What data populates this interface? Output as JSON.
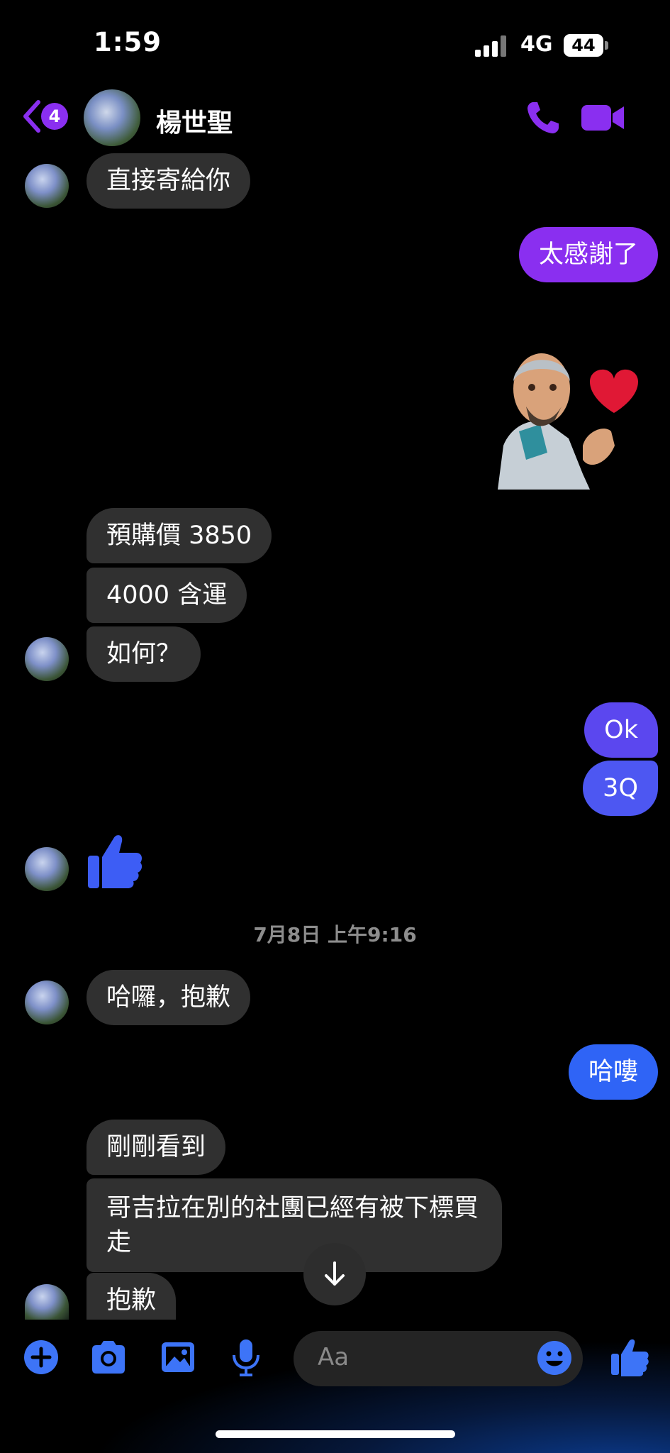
{
  "status_bar": {
    "time": "1:59",
    "network": "4G",
    "battery": "44"
  },
  "header": {
    "back_badge": "4",
    "contact_name": "楊世聖"
  },
  "colors": {
    "accent_purple": "#8a2ff0",
    "accent_blue": "#2f64f6",
    "incoming_bubble": "#303030"
  },
  "messages": [
    {
      "side": "in",
      "text": "直接寄給你"
    },
    {
      "side": "out",
      "text": "太感謝了"
    },
    {
      "side": "out",
      "type": "sticker",
      "icon": "avatar-heart-sticker"
    },
    {
      "side": "in",
      "text": "預購價 3850"
    },
    {
      "side": "in",
      "text": "4000 含運"
    },
    {
      "side": "in",
      "text": "如何？"
    },
    {
      "side": "out",
      "text": "Ok"
    },
    {
      "side": "out",
      "text": "3Q"
    },
    {
      "side": "in",
      "type": "like",
      "icon": "thumbs-up-icon"
    },
    {
      "side": "in",
      "text": "哈囉，抱歉"
    },
    {
      "side": "out",
      "text": "哈嘍"
    },
    {
      "side": "in",
      "text": "剛剛看到"
    },
    {
      "side": "in",
      "text": "哥吉拉在別的社團已經有被下標買走"
    },
    {
      "side": "in",
      "text": "抱歉"
    }
  ],
  "timestamp": "7月8日 上午9:16",
  "composer": {
    "placeholder": "Aa"
  },
  "icons": [
    "plus-icon",
    "camera-icon",
    "image-icon",
    "microphone-icon",
    "emoji-icon",
    "thumbs-up-icon",
    "arrow-down-icon",
    "phone-icon",
    "video-camera-icon",
    "chevron-left-icon"
  ]
}
